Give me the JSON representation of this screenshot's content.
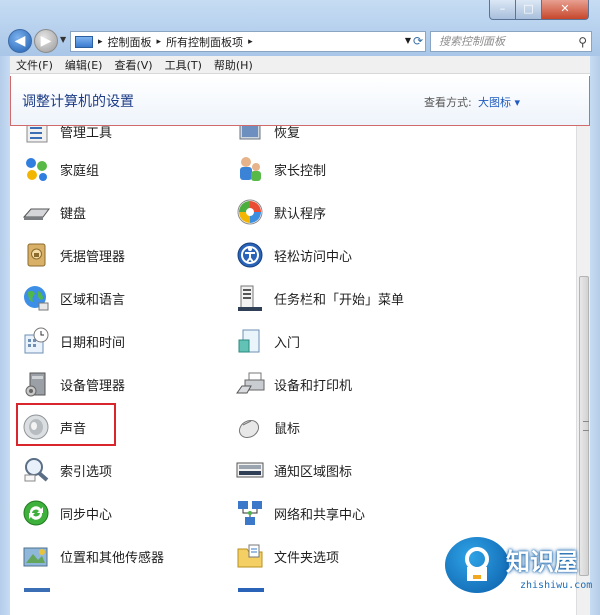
{
  "address": {
    "path": [
      "控制面板",
      "所有控制面板项"
    ],
    "search_placeholder": "搜索控制面板"
  },
  "menu": [
    "文件(F)",
    "编辑(E)",
    "查看(V)",
    "工具(T)",
    "帮助(H)"
  ],
  "header": {
    "title": "调整计算机的设置",
    "view_label": "查看方式:",
    "view_value": "大图标 ▾"
  },
  "items_col1": [
    {
      "label": "管理工具",
      "icon": "admin-tools-icon"
    },
    {
      "label": "家庭组",
      "icon": "homegroup-icon"
    },
    {
      "label": "键盘",
      "icon": "keyboard-icon"
    },
    {
      "label": "凭据管理器",
      "icon": "credential-manager-icon"
    },
    {
      "label": "区域和语言",
      "icon": "region-language-icon"
    },
    {
      "label": "日期和时间",
      "icon": "date-time-icon"
    },
    {
      "label": "设备管理器",
      "icon": "device-manager-icon"
    },
    {
      "label": "声音",
      "icon": "sound-icon"
    },
    {
      "label": "索引选项",
      "icon": "indexing-options-icon"
    },
    {
      "label": "同步中心",
      "icon": "sync-center-icon"
    },
    {
      "label": "位置和其他传感器",
      "icon": "location-sensors-icon"
    }
  ],
  "items_col2": [
    {
      "label": "恢复",
      "icon": "recovery-icon"
    },
    {
      "label": "家长控制",
      "icon": "parental-controls-icon"
    },
    {
      "label": "默认程序",
      "icon": "default-programs-icon"
    },
    {
      "label": "轻松访问中心",
      "icon": "ease-of-access-icon"
    },
    {
      "label": "任务栏和「开始」菜单",
      "icon": "taskbar-start-menu-icon"
    },
    {
      "label": "入门",
      "icon": "getting-started-icon"
    },
    {
      "label": "设备和打印机",
      "icon": "devices-printers-icon"
    },
    {
      "label": "鼠标",
      "icon": "mouse-icon"
    },
    {
      "label": "通知区域图标",
      "icon": "notification-icons-icon"
    },
    {
      "label": "网络和共享中心",
      "icon": "network-sharing-icon"
    },
    {
      "label": "文件夹选项",
      "icon": "folder-options-icon"
    }
  ],
  "watermark": {
    "title": "知识屋",
    "subtitle": "zhishiwu.com"
  }
}
